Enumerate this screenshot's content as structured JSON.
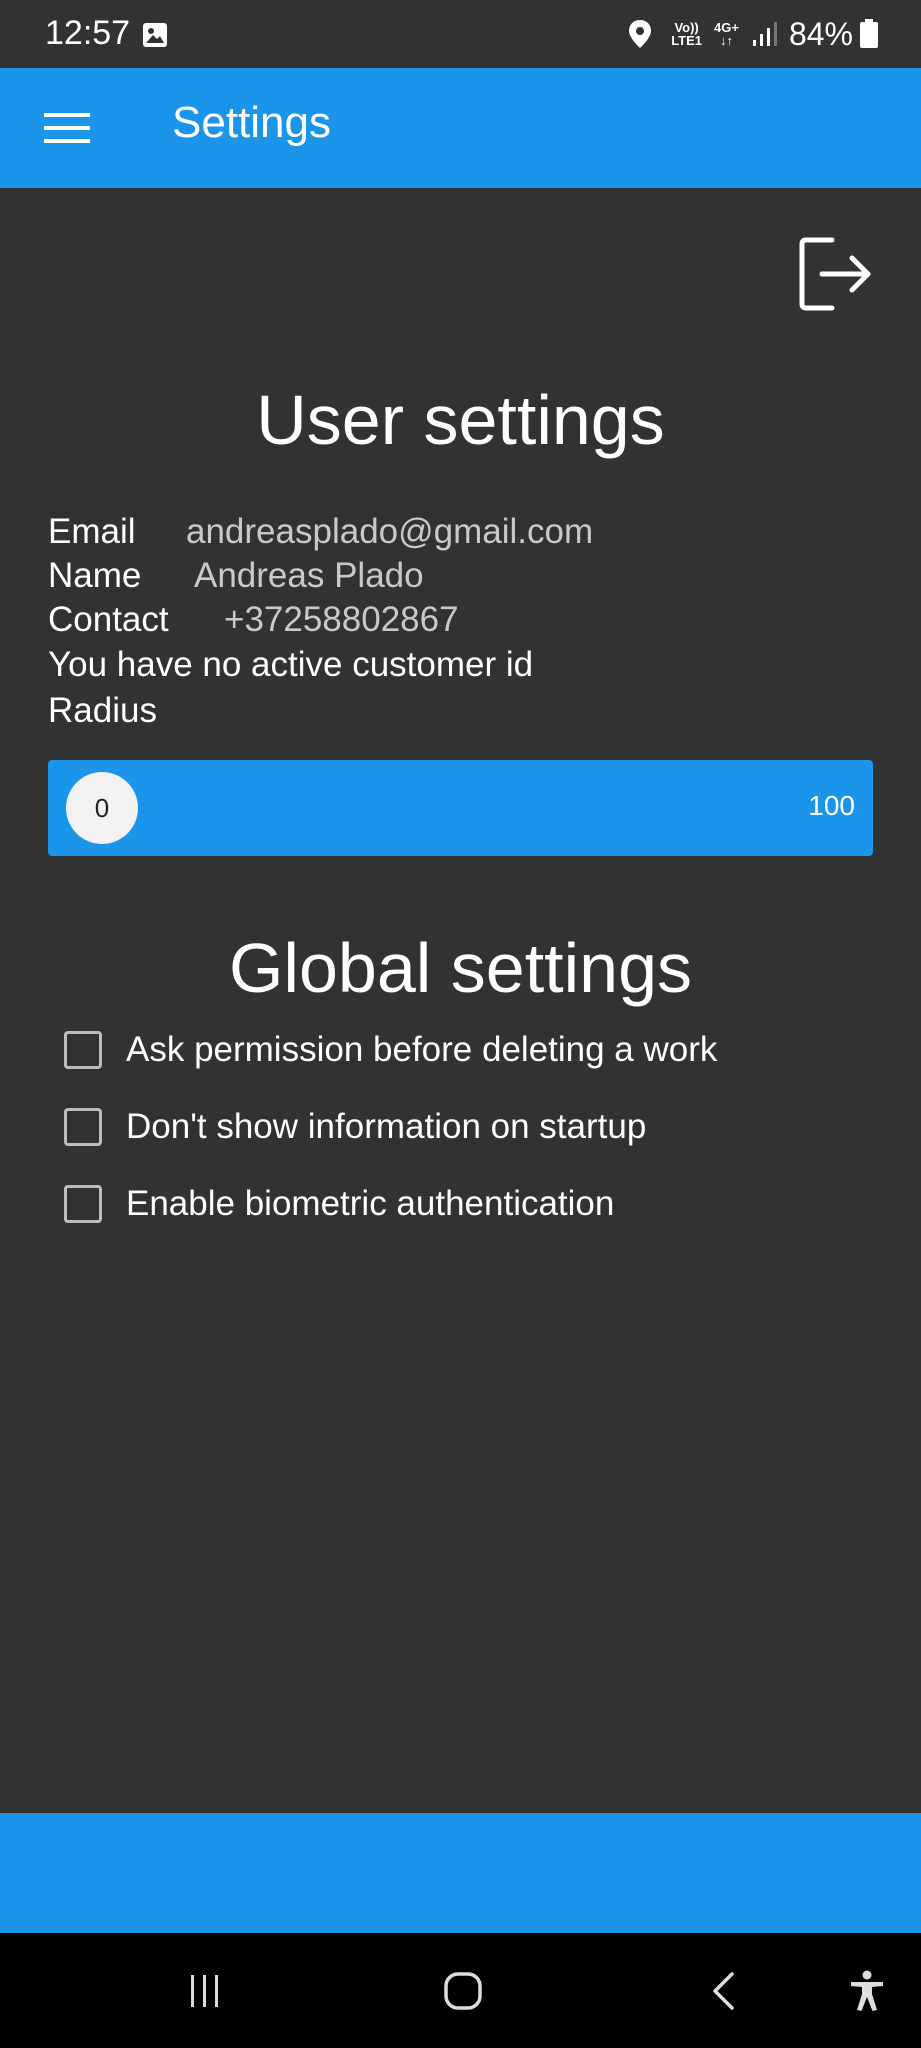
{
  "status_bar": {
    "time": "12:57",
    "volte_top": "Vo))",
    "volte_bottom": "LTE1",
    "network_top": "4G+",
    "network_bottom": "↓↑",
    "battery": "84%",
    "icons": [
      "gallery-icon",
      "location-icon",
      "signal-icon",
      "battery-icon"
    ]
  },
  "app_bar": {
    "title": "Settings",
    "menu_icon": "hamburger-menu-icon",
    "color": "#1a95ea"
  },
  "logout": {
    "icon": "logout-icon"
  },
  "user_settings": {
    "title": "User settings",
    "email_label": "Email",
    "email_value": "andreasplado@gmail.com",
    "name_label": "Name",
    "name_value": "Andreas Plado",
    "contact_label": "Contact",
    "contact_value": "+37258802867",
    "customer_text": "You have no active customer id",
    "radius_label": "Radius",
    "radius_value": "0",
    "radius_max": "100"
  },
  "global_settings": {
    "title": "Global settings",
    "options": [
      {
        "label": "Ask permission before deleting a work",
        "checked": false
      },
      {
        "label": "Don't show information on startup",
        "checked": false
      },
      {
        "label": "Enable biometric authentication",
        "checked": false
      }
    ]
  },
  "navigation": {
    "buttons": [
      "recent-apps-icon",
      "home-icon",
      "back-icon",
      "accessibility-icon"
    ]
  },
  "colors": {
    "background": "#323232",
    "accent": "#1a95ea",
    "nav_bar": "#000000"
  }
}
